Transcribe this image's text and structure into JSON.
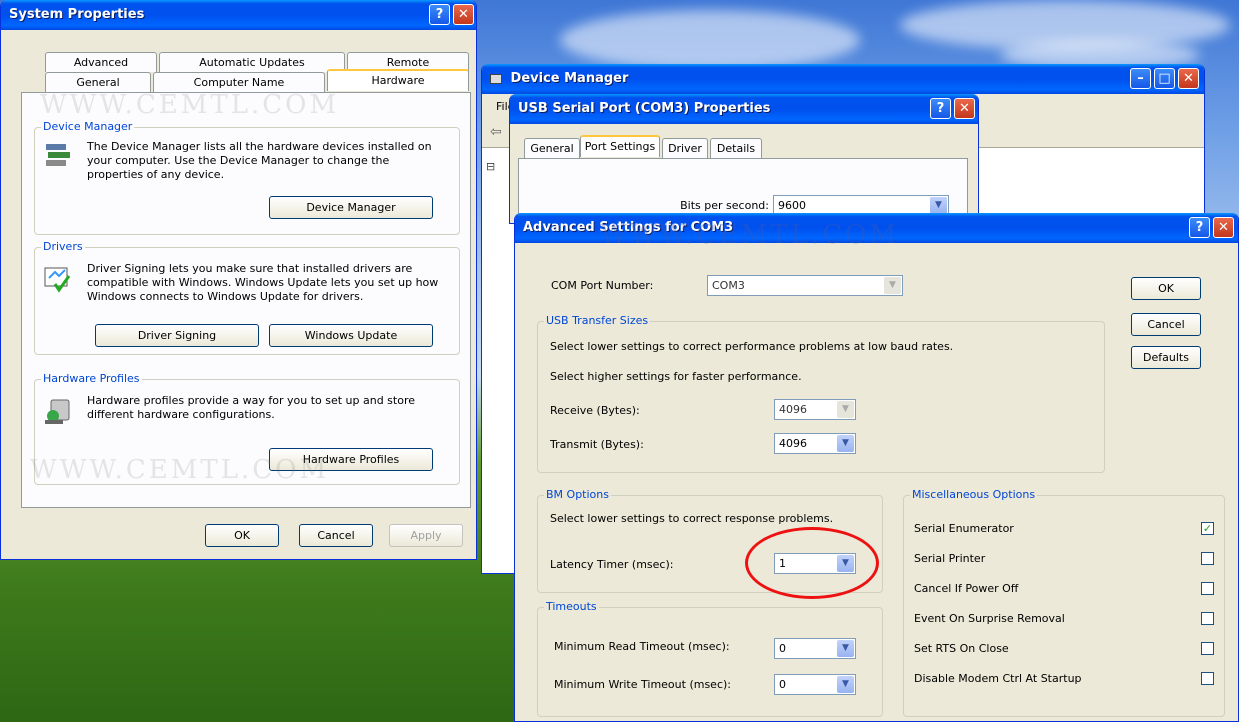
{
  "sys": {
    "title": "System Properties",
    "tabs_back": [
      "Advanced",
      "Automatic Updates",
      "Remote"
    ],
    "tabs_front": [
      "General",
      "Computer Name",
      "Hardware"
    ],
    "device_manager": {
      "label": "Device Manager",
      "text": "The Device Manager lists all the hardware devices installed on your computer. Use the Device Manager to change the properties of any device.",
      "button": "Device Manager"
    },
    "drivers": {
      "label": "Drivers",
      "text": "Driver Signing lets you make sure that installed drivers are compatible with Windows. Windows Update lets you set up how Windows connects to Windows Update for drivers.",
      "btn_signing": "Driver Signing",
      "btn_update": "Windows Update"
    },
    "profiles": {
      "label": "Hardware Profiles",
      "text": "Hardware profiles provide a way for you to set up and store different hardware configurations.",
      "button": "Hardware Profiles"
    },
    "ok": "OK",
    "cancel": "Cancel",
    "apply": "Apply"
  },
  "devmgr": {
    "title": "Device Manager",
    "menu_file": "File"
  },
  "serial": {
    "title": "USB Serial Port (COM3) Properties",
    "tabs": [
      "General",
      "Port Settings",
      "Driver",
      "Details"
    ],
    "bits_label": "Bits per second:",
    "bits_value": "9600"
  },
  "adv": {
    "title": "Advanced Settings for COM3",
    "com_label": "COM Port Number:",
    "com_value": "COM3",
    "usb_label": "USB Transfer Sizes",
    "usb_text1": "Select lower settings to correct performance problems at low baud rates.",
    "usb_text2": "Select higher settings for faster performance.",
    "receive_label": "Receive (Bytes):",
    "receive_value": "4096",
    "transmit_label": "Transmit (Bytes):",
    "transmit_value": "4096",
    "bm_label": "BM Options",
    "bm_text": "Select lower settings to correct response problems.",
    "latency_label": "Latency Timer (msec):",
    "latency_value": "1",
    "timeouts_label": "Timeouts",
    "read_label": "Minimum Read Timeout (msec):",
    "read_value": "0",
    "write_label": "Minimum Write Timeout (msec):",
    "write_value": "0",
    "misc_label": "Miscellaneous Options",
    "misc": [
      {
        "label": "Serial Enumerator",
        "checked": true
      },
      {
        "label": "Serial Printer",
        "checked": false
      },
      {
        "label": "Cancel If Power Off",
        "checked": false
      },
      {
        "label": "Event On Surprise Removal",
        "checked": false
      },
      {
        "label": "Set RTS On Close",
        "checked": false
      },
      {
        "label": "Disable Modem Ctrl At Startup",
        "checked": false
      }
    ],
    "ok": "OK",
    "cancel": "Cancel",
    "defaults": "Defaults"
  },
  "watermark": "WWW.CEMTL.COM",
  "colors": {
    "xp_blue": "#0053ee",
    "close_red": "#c3361c",
    "highlight_ellipse": "#ee1111"
  }
}
